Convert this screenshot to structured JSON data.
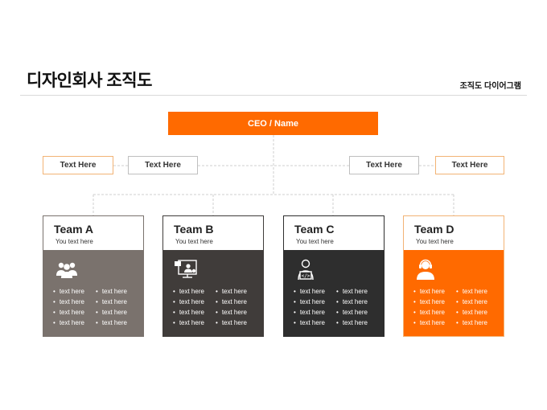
{
  "header": {
    "title": "디자인회사 조직도",
    "subtitle": "조직도 다이어그램"
  },
  "ceo": {
    "label": "CEO / Name"
  },
  "side_boxes": [
    {
      "label": "Text Here"
    },
    {
      "label": "Text Here"
    },
    {
      "label": "Text Here"
    },
    {
      "label": "Text Here"
    }
  ],
  "teams": [
    {
      "name": "Team A",
      "subtitle": "You text here",
      "icon": "people-group-icon",
      "color": "#7a726d",
      "col1": [
        "text here",
        "text here",
        "text here",
        "text here"
      ],
      "col2": [
        "text here",
        "text here",
        "text here",
        "text here"
      ]
    },
    {
      "name": "Team B",
      "subtitle": "You text here",
      "icon": "presentation-icon",
      "color": "#403c3a",
      "col1": [
        "text here",
        "text here",
        "text here",
        "text here"
      ],
      "col2": [
        "text here",
        "text here",
        "text here",
        "text here"
      ]
    },
    {
      "name": "Team C",
      "subtitle": "You text here",
      "icon": "developer-icon",
      "color": "#2e2e2e",
      "col1": [
        "text here",
        "text here",
        "text here",
        "text here"
      ],
      "col2": [
        "text here",
        "text here",
        "text here",
        "text here"
      ]
    },
    {
      "name": "Team D",
      "subtitle": "You text here",
      "icon": "headset-support-icon",
      "color": "#ff6a00",
      "col1": [
        "text here",
        "text here",
        "text here",
        "text here"
      ],
      "col2": [
        "text here",
        "text here",
        "text here",
        "text here"
      ]
    }
  ],
  "colors": {
    "accent": "#ff6a00",
    "connector": "#cfcfcf"
  }
}
